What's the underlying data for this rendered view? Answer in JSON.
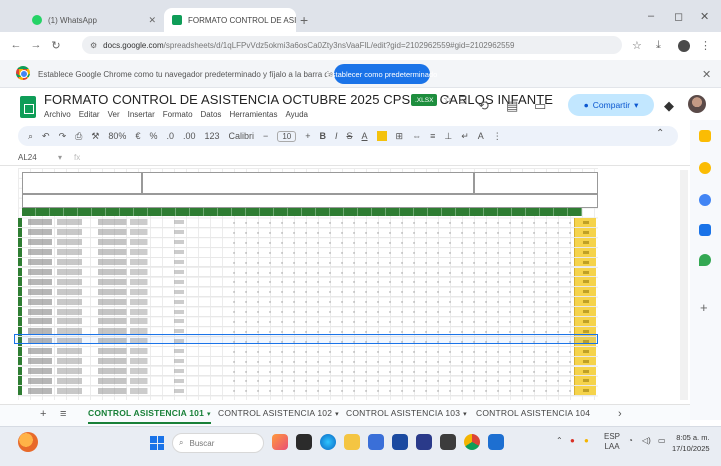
{
  "browser": {
    "tabs": [
      {
        "label": "(1) WhatsApp",
        "icon": "whatsapp-icon",
        "color": "#25d366"
      },
      {
        "label": "FORMATO CONTROL DE ASIS",
        "icon": "sheets-icon",
        "color": "#0f9d58"
      }
    ],
    "new_tab": "+",
    "url_domain": "docs.google.com",
    "url_path": "/spreadsheets/d/1qLFPvVdz5okmi3a6osCa0Zty3nsVaaFlL/edit?gid=2102962559#gid=2102962559",
    "window_controls": [
      "–",
      "◻",
      "✕"
    ]
  },
  "infobar": {
    "message": "Establece Google Chrome como tu navegador predeterminado y fíjalo a la barra de tareas",
    "button": "Establecer como predeterminado",
    "close": "✕"
  },
  "sheets": {
    "title": "FORMATO CONTROL DE ASISTENCIA OCTUBRE 2025 CPS 260 CARLOS INFANTE",
    "badge": ".XLSX",
    "menu": [
      "Archivo",
      "Editar",
      "Ver",
      "Insertar",
      "Formato",
      "Datos",
      "Herramientas",
      "Ayuda"
    ],
    "share_label": "Compartir",
    "toolbar": {
      "zoom": "80%",
      "currency": "€",
      "percent": "%",
      "decimals_down": ".0",
      "decimals_up": ".00",
      "format_123": "123",
      "font": "Calibri",
      "font_size": "10",
      "bold": "B",
      "italic": "I",
      "strike": "S",
      "text_color": "A"
    },
    "name_box": "AL24",
    "fx": "fx"
  },
  "sheet_tabs": {
    "add": "+",
    "menu": "≡",
    "tabs": [
      "CONTROL ASISTENCIA 101",
      "CONTROL ASISTENCIA 102",
      "CONTROL ASISTENCIA 103",
      "CONTROL ASISTENCIA 104"
    ],
    "active_index": 0,
    "more": "›"
  },
  "taskbar": {
    "search": "Buscar",
    "lang": "ESP",
    "lang_sub": "LAA",
    "time": "8:05 a. m.",
    "date": "17/10/2025"
  },
  "colors": {
    "sheet_green": "#2e7d32",
    "highlight_yellow": "#f5d34b",
    "share_bg": "#c2e7ff",
    "accent_blue": "#1a73e8"
  }
}
